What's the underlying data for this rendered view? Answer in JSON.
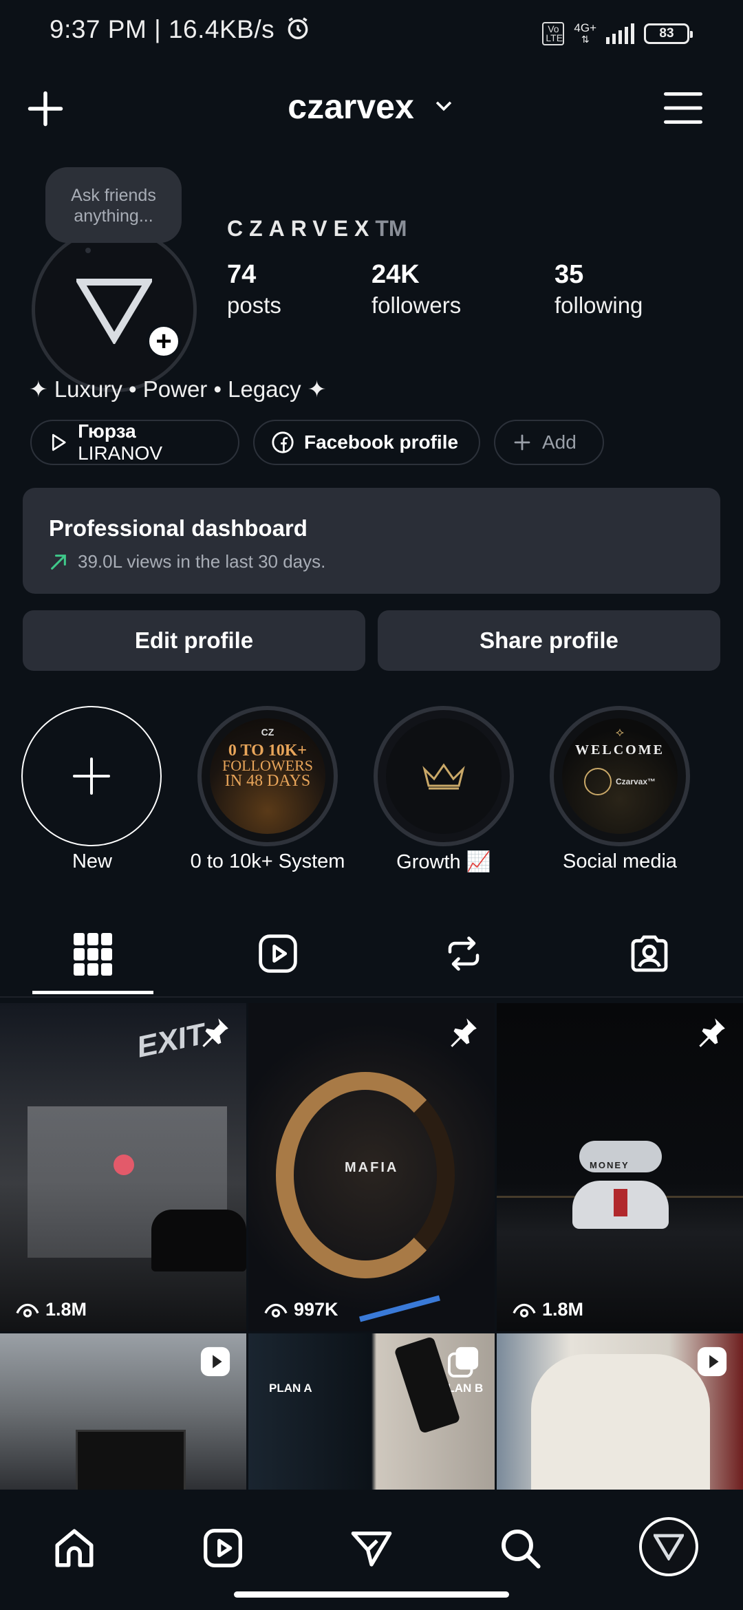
{
  "status": {
    "time_speed": "9:37 PM | 16.4KB/s",
    "volte": "Vo LTE",
    "network": "4G+",
    "battery": "83"
  },
  "header": {
    "username": "czarvex"
  },
  "profile": {
    "bubble": "Ask friends anything...",
    "display_name": "CZARVEX",
    "tm": "TM",
    "stats": [
      {
        "num": "74",
        "label": "posts"
      },
      {
        "num": "24K",
        "label": "followers"
      },
      {
        "num": "35",
        "label": "following"
      }
    ],
    "bio": "✦ Luxury • Power • Legacy ✦",
    "chips": {
      "music_name": "Гюрза",
      "music_artist": "LIRANOV",
      "facebook": "Facebook profile",
      "add": "Add"
    }
  },
  "dashboard": {
    "title": "Professional dashboard",
    "subtitle": "39.0L views in the last 30 days."
  },
  "buttons": {
    "edit": "Edit profile",
    "share": "Share profile"
  },
  "highlights": [
    {
      "label": "New"
    },
    {
      "label": "0 to 10k+ System",
      "art_top": "CZ",
      "art_line1": "0 TO 10K+",
      "art_line2": "FOLLOWERS",
      "art_line3": "IN 48 DAYS"
    },
    {
      "label": "Growth 📈"
    },
    {
      "label": "Social media",
      "art_line1": "WELCOME",
      "art_line2": "Czarvax™"
    }
  ],
  "grid": [
    {
      "views": "1.8M",
      "overlay": "EXIT",
      "badge": "pin"
    },
    {
      "views": "997K",
      "overlay": "MAFIA",
      "badge": "pin"
    },
    {
      "views": "1.8M",
      "overlay": "MONEY",
      "badge": "pin"
    },
    {
      "badge": "reel"
    },
    {
      "overlay": "PLAN A",
      "overlay2": "PLAN B",
      "badge": "carousel"
    },
    {
      "badge": "reel"
    }
  ],
  "colors": {
    "bg": "#0c1117",
    "card": "#2a2e37",
    "accent_green": "#3fc98a"
  }
}
